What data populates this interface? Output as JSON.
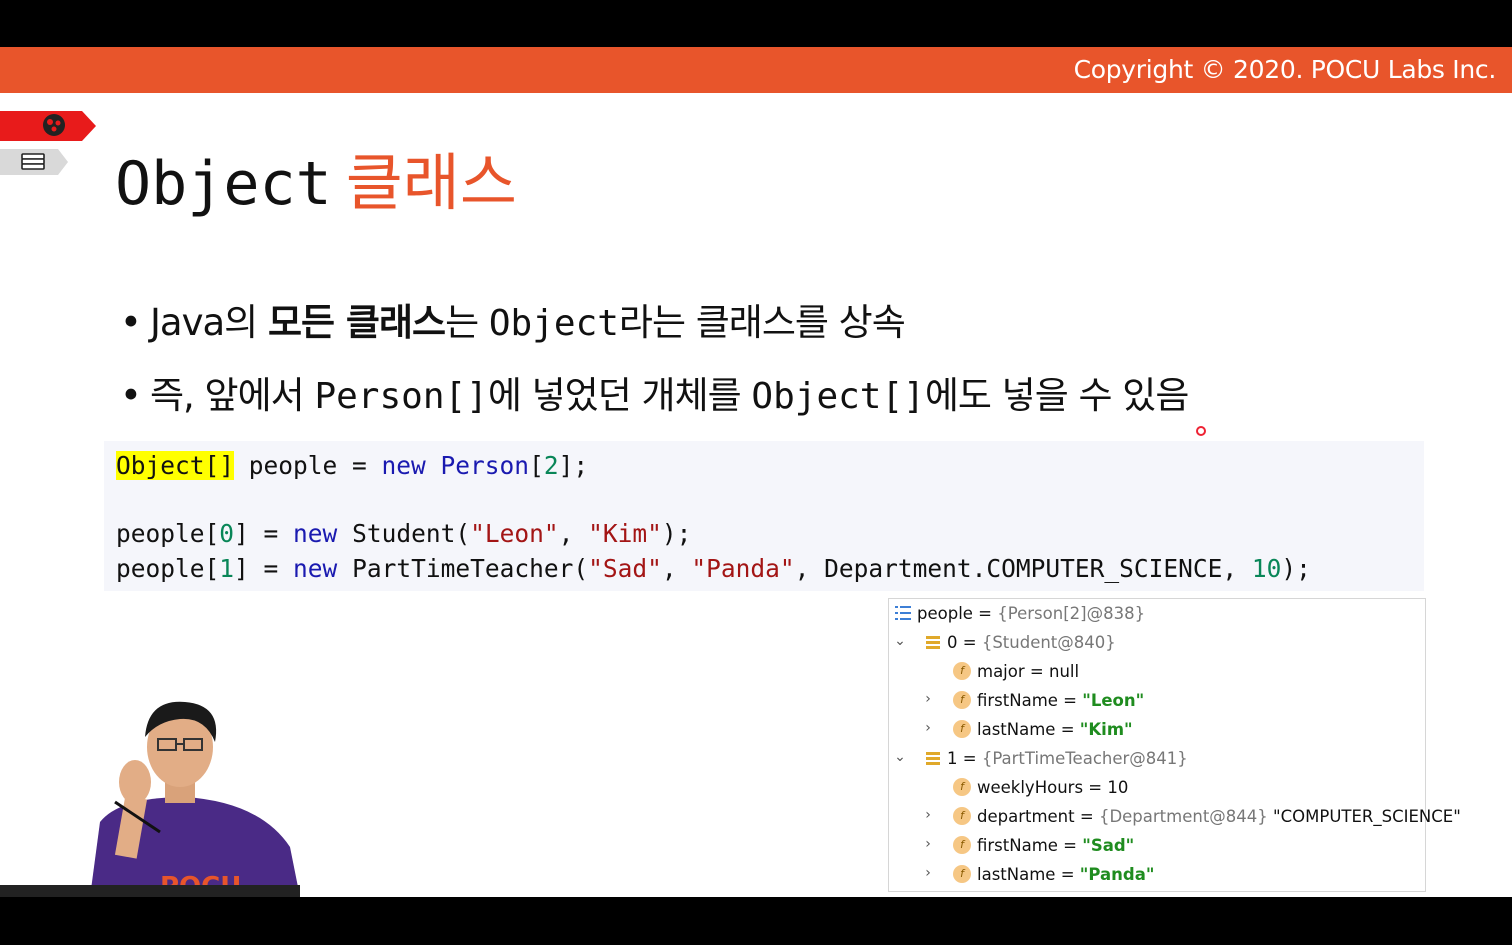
{
  "copyright": "Copyright © 2020. POCU Labs Inc.",
  "title": {
    "code": "Object",
    "korean": "클래스"
  },
  "bullets": [
    {
      "p1": "Java의 ",
      "bold": "모든 클래스",
      "p2": "는 ",
      "mono": "Object",
      "p3": "라는 클래스를 상속"
    },
    {
      "p1": "즉, 앞에서 ",
      "mono1": "Person[]",
      "p2": "에 넣었던 개체를 ",
      "mono2": "Object[]",
      "p3": "에도 넣을 수 있음"
    }
  ],
  "code": {
    "l1_highlight": "Object[]",
    "l1_var": " people = ",
    "l1_new": "new",
    "l1_type": " Person",
    "l1_b1": "[",
    "l1_n": "2",
    "l1_b2": "];",
    "l2_a": "people[",
    "l2_idx": "0",
    "l2_b": "] = ",
    "l2_new": "new",
    "l2_c": " Student(",
    "l2_s1": "\"Leon\"",
    "l2_d": ", ",
    "l2_s2": "\"Kim\"",
    "l2_e": ");",
    "l3_a": "people[",
    "l3_idx": "1",
    "l3_b": "] = ",
    "l3_new": "new",
    "l3_c": " PartTimeTeacher(",
    "l3_s1": "\"Sad\"",
    "l3_d": ", ",
    "l3_s2": "\"Panda\"",
    "l3_e": ", Department.COMPUTER_SCIENCE, ",
    "l3_n": "10",
    "l3_f": ");"
  },
  "debugger": {
    "rows": [
      {
        "name": "people",
        "eq": " = ",
        "val": "{Person[2]@838}",
        "valtype": "grey"
      },
      {
        "name": "0",
        "eq": " = ",
        "val": "{Student@840}",
        "valtype": "grey"
      },
      {
        "name": "major",
        "eq": " = ",
        "val": "null",
        "valtype": "plain"
      },
      {
        "name": "firstName",
        "eq": " = ",
        "val": "\"Leon\"",
        "valtype": "green"
      },
      {
        "name": "lastName",
        "eq": " = ",
        "val": "\"Kim\"",
        "valtype": "green"
      },
      {
        "name": "1",
        "eq": " = ",
        "val": "{PartTimeTeacher@841}",
        "valtype": "grey"
      },
      {
        "name": "weeklyHours",
        "eq": " = ",
        "val": "10",
        "valtype": "plain"
      },
      {
        "name": "department",
        "eq": " = ",
        "val": "{Department@844}",
        "val2": " \"COMPUTER_SCIENCE\"",
        "valtype": "grey"
      },
      {
        "name": "firstName",
        "eq": " = ",
        "val": "\"Sad\"",
        "valtype": "green"
      },
      {
        "name": "lastName",
        "eq": " = ",
        "val": "\"Panda\"",
        "valtype": "green"
      }
    ],
    "field_icon_letter": "f"
  },
  "presenter_logo_text": "POCU",
  "colors": {
    "brand": "#e8552b",
    "highlight": "#ffff00",
    "keyword": "#1a1ab0",
    "string": "#a31515",
    "number": "#098658",
    "green": "#1f8c1f"
  },
  "icons": [
    "brain-icon",
    "books-icon",
    "list-icon",
    "chevron-down-icon",
    "chevron-right-icon",
    "field-icon"
  ]
}
